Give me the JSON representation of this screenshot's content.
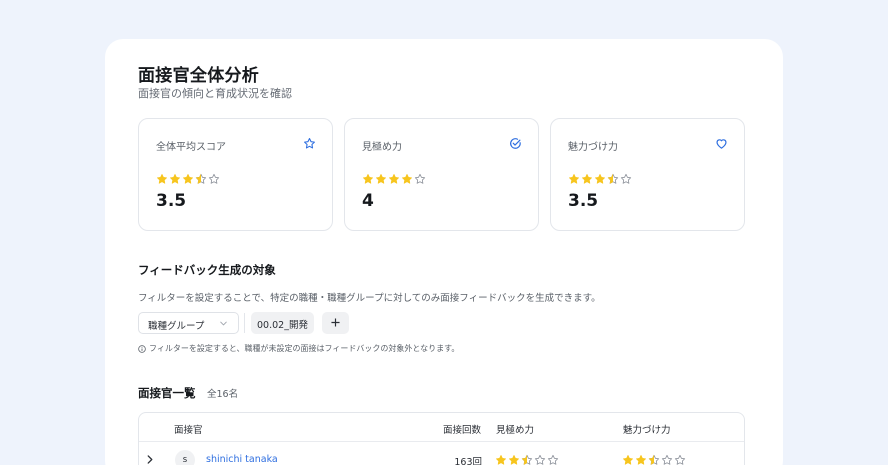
{
  "page": {
    "title": "面接官全体分析",
    "subtitle": "面接官の傾向と育成状況を確認"
  },
  "cards": [
    {
      "label": "全体平均スコア",
      "icon": "star-outline-icon",
      "value": "3.5",
      "rating": 3.5
    },
    {
      "label": "見極め力",
      "icon": "check-circle-icon",
      "value": "4",
      "rating": 4
    },
    {
      "label": "魅力づけ力",
      "icon": "heart-outline-icon",
      "value": "3.5",
      "rating": 3.5
    }
  ],
  "feedback": {
    "title": "フィードバック生成の対象",
    "description": "フィルターを設定することで、特定の職種・職種グループに対してのみ面接フィードバックを生成できます。",
    "select_value": "職種グループ",
    "tag": "00.02_開発",
    "note": "フィルターを設定すると、職種が未設定の面接はフィードバックの対象外となります。"
  },
  "list": {
    "title": "面接官一覧",
    "count": "全16名",
    "columns": {
      "interviewer": "面接官",
      "interviews": "面接回数",
      "assessment": "見極め力",
      "attraction": "魅力づけ力"
    },
    "rows": [
      {
        "avatar": "s",
        "name": "shinichi tanaka",
        "interviews": "163回",
        "assessment_rating": 2.5,
        "attraction_rating": 2.5
      }
    ]
  },
  "colors": {
    "star_fill": "#f7c51e",
    "star_empty_stroke": "#8a8f98",
    "accent": "#2f6fe0",
    "page_bg": "#eef3fc"
  }
}
